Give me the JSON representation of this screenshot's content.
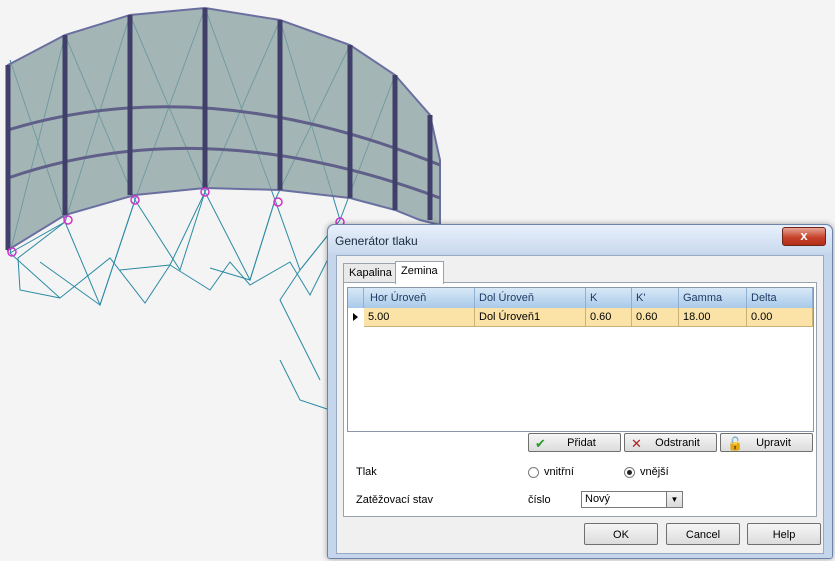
{
  "dialog": {
    "title": "Generátor tlaku",
    "close_label": "x"
  },
  "tabs": [
    {
      "label": "Kapalina",
      "active": false
    },
    {
      "label": "Zemina",
      "active": true
    }
  ],
  "grid": {
    "columns": [
      "Hor Úroveň",
      "Dol Úroveň",
      "K",
      "K'",
      "Gamma",
      "Delta"
    ],
    "rows": [
      [
        "5.00",
        "Dol Úroveň1",
        "0.60",
        "0.60",
        "18.00",
        "0.00"
      ]
    ]
  },
  "buttons": {
    "add": "Přidat",
    "remove": "Odstranit",
    "edit": "Upravit",
    "ok": "OK",
    "cancel": "Cancel",
    "help": "Help"
  },
  "pressure": {
    "label": "Tlak",
    "inner": "vnitřní",
    "outer": "vnější",
    "selected": "outer"
  },
  "loadcase": {
    "label": "Zatěžovací stav",
    "number_label": "číslo",
    "value": "Nový"
  },
  "colors": {
    "wall": "#8aa0a0",
    "wireframe": "#2a8aa3",
    "support": "#cc33cc",
    "row_highlight": "#fbe3a8"
  }
}
